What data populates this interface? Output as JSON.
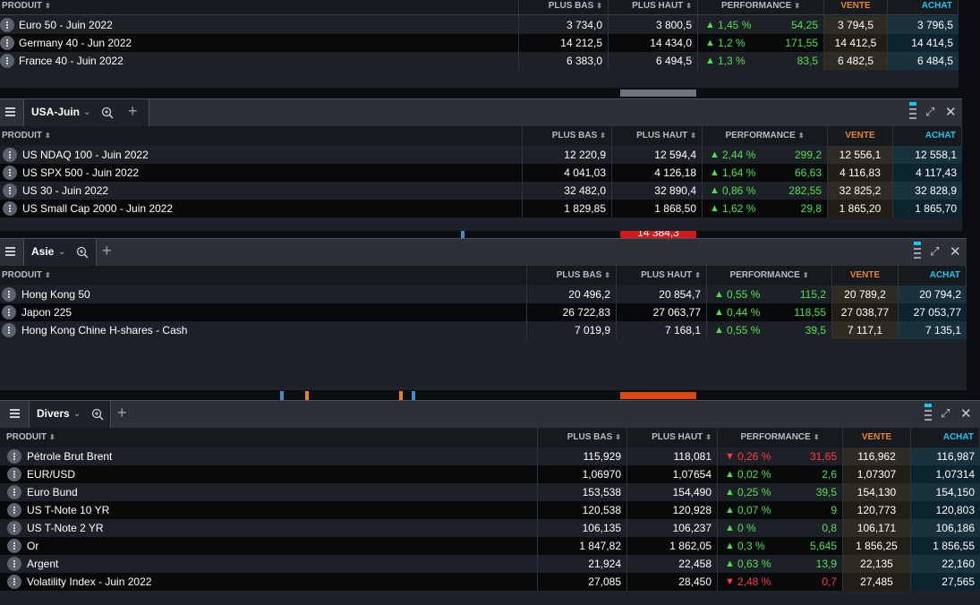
{
  "columns": {
    "produit": "PRODUIT",
    "plus_bas": "PLUS BAS",
    "plus_haut": "PLUS HAUT",
    "performance": "PERFORMANCE",
    "vente": "VENTE",
    "achat": "ACHAT",
    "sort_glyph": "⬍"
  },
  "colors": {
    "up": "#4ee24e",
    "down": "#ff3b3b",
    "vente": "#e9842a",
    "achat": "#18c6ef"
  },
  "panel1": {
    "rows": [
      {
        "name": "Euro 50 - Juin 2022",
        "low": "3 734,0",
        "high": "3 800,5",
        "dir": "up",
        "pct": "1,45 %",
        "chg": "54,25",
        "sell": "3 794,5",
        "buy": "3 796,5"
      },
      {
        "name": "Germany 40 - Jun 2022",
        "low": "14 212,5",
        "high": "14 434,0",
        "dir": "up",
        "pct": "1,2 %",
        "chg": "171,55",
        "sell": "14 412,5",
        "buy": "14 414,5"
      },
      {
        "name": "France 40 - Juin 2022",
        "low": "6 383,0",
        "high": "6 494,5",
        "dir": "up",
        "pct": "1,3 %",
        "chg": "83,5",
        "sell": "6 482,5",
        "buy": "6 484,5"
      }
    ]
  },
  "panel2": {
    "tab": "USA-Juin",
    "rows": [
      {
        "name": "US NDAQ 100 - Juin 2022",
        "low": "12 220,9",
        "high": "12 594,4",
        "dir": "up",
        "pct": "2,44 %",
        "chg": "299,2",
        "sell": "12 556,1",
        "buy": "12 558,1"
      },
      {
        "name": "US SPX 500 - Juin 2022",
        "low": "4 041,03",
        "high": "4 126,18",
        "dir": "up",
        "pct": "1,64 %",
        "chg": "66,63",
        "sell": "4 116,83",
        "buy": "4 117,43"
      },
      {
        "name": "US 30 - Juin 2022",
        "low": "32 482,0",
        "high": "32 890,4",
        "dir": "up",
        "pct": "0,86 %",
        "chg": "282,55",
        "sell": "32 825,2",
        "buy": "32 828,9"
      },
      {
        "name": "US Small Cap 2000 - Juin 2022",
        "low": "1 829,85",
        "high": "1 868,50",
        "dir": "up",
        "pct": "1,62 %",
        "chg": "29,8",
        "sell": "1 865,20",
        "buy": "1 865,70"
      }
    ]
  },
  "panel3": {
    "tab": "Asie",
    "rows": [
      {
        "name": "Hong Kong 50",
        "low": "20 496,2",
        "high": "20 854,7",
        "dir": "up",
        "pct": "0,55 %",
        "chg": "115,2",
        "sell": "20 789,2",
        "buy": "20 794,2"
      },
      {
        "name": "Japon 225",
        "low": "26 722,83",
        "high": "27 063,77",
        "dir": "up",
        "pct": "0,44 %",
        "chg": "118,55",
        "sell": "27 038,77",
        "buy": "27 053,77"
      },
      {
        "name": "Hong Kong Chine H-shares - Cash",
        "low": "7 019,9",
        "high": "7 168,1",
        "dir": "up",
        "pct": "0,55 %",
        "chg": "39,5",
        "sell": "7 117,1",
        "buy": "7 135,1"
      }
    ]
  },
  "panel4": {
    "tab": "Divers",
    "rows": [
      {
        "name": "Pétrole Brut Brent",
        "low": "115,929",
        "high": "118,081",
        "dir": "dn",
        "pct": "0,26 %",
        "chg": "31,65",
        "sell": "116,962",
        "buy": "116,987"
      },
      {
        "name": "EUR/USD",
        "low": "1,06970",
        "high": "1,07654",
        "dir": "up",
        "pct": "0,02 %",
        "chg": "2,6",
        "sell": "1,07307",
        "buy": "1,07314"
      },
      {
        "name": "Euro Bund",
        "low": "153,538",
        "high": "154,490",
        "dir": "up",
        "pct": "0,25 %",
        "chg": "39,5",
        "sell": "154,130",
        "buy": "154,150"
      },
      {
        "name": "US T-Note 10 YR",
        "low": "120,538",
        "high": "120,928",
        "dir": "up",
        "pct": "0,07 %",
        "chg": "9",
        "sell": "120,773",
        "buy": "120,803"
      },
      {
        "name": "US T-Note 2 YR",
        "low": "106,135",
        "high": "106,237",
        "dir": "up",
        "pct": "0 %",
        "chg": "0,8",
        "sell": "106,171",
        "buy": "106,186"
      },
      {
        "name": "Or",
        "low": "1 847,82",
        "high": "1 862,05",
        "dir": "up",
        "pct": "0,3 %",
        "chg": "5,645",
        "sell": "1 856,25",
        "buy": "1 856,55"
      },
      {
        "name": "Argent",
        "low": "21,924",
        "high": "22,458",
        "dir": "up",
        "pct": "0,63 %",
        "chg": "13,9",
        "sell": "22,135",
        "buy": "22,160"
      },
      {
        "name": "Volatility Index - Juin 2022",
        "low": "27,085",
        "high": "28,450",
        "dir": "dn",
        "pct": "2,48 %",
        "chg": "0,7",
        "sell": "27,485",
        "buy": "27,565"
      }
    ]
  },
  "background_label": "14 384,3"
}
